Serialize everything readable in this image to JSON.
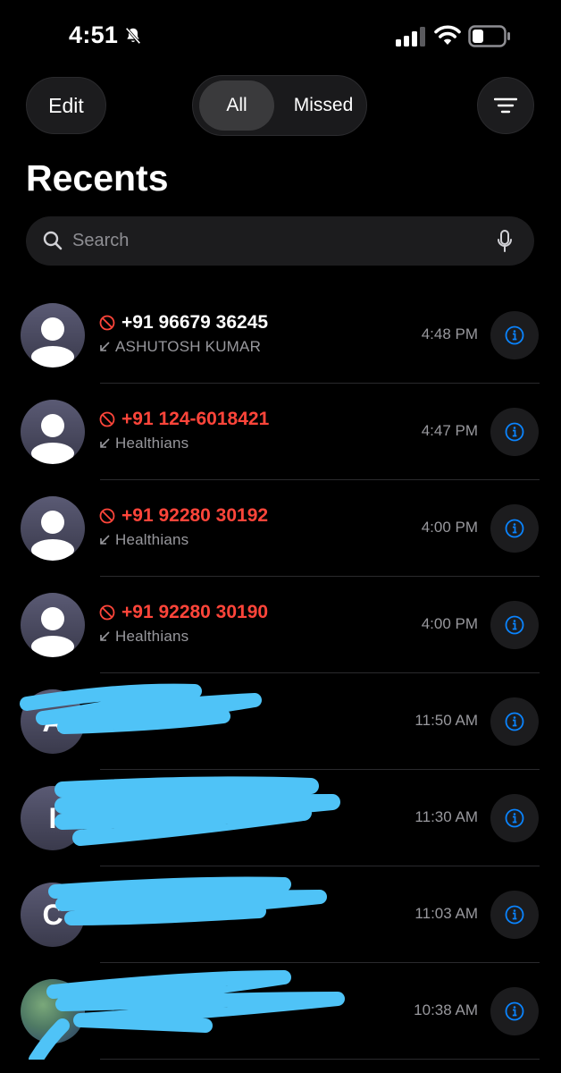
{
  "status": {
    "time": "4:51"
  },
  "header": {
    "edit_label": "Edit",
    "tabs": [
      {
        "label": "All",
        "selected": true
      },
      {
        "label": "Missed",
        "selected": false
      }
    ],
    "title": "Recents"
  },
  "search": {
    "placeholder": "Search"
  },
  "colors": {
    "missed": "#ff453a",
    "accent": "#0a84ff",
    "redaction": "#4fc3f7"
  },
  "calls": [
    {
      "name": "+91 96679 36245",
      "subtitle": "ASHUTOSH KUMAR",
      "time": "4:48 PM",
      "missed": false,
      "blocked": true
    },
    {
      "name": "+91 124-6018421",
      "subtitle": "Healthians",
      "time": "4:47 PM",
      "missed": true,
      "blocked": true
    },
    {
      "name": "+91 92280 30192",
      "subtitle": "Healthians",
      "time": "4:00 PM",
      "missed": true,
      "blocked": true
    },
    {
      "name": "+91 92280 30190",
      "subtitle": "Healthians",
      "time": "4:00 PM",
      "missed": true,
      "blocked": true
    },
    {
      "initial": "A",
      "time": "11:50 AM",
      "redacted": true
    },
    {
      "initial": "I",
      "time": "11:30 AM",
      "redacted": true
    },
    {
      "initial": "C",
      "time": "11:03 AM",
      "redacted": true
    },
    {
      "photo": true,
      "time": "10:38 AM",
      "redacted": true
    }
  ]
}
